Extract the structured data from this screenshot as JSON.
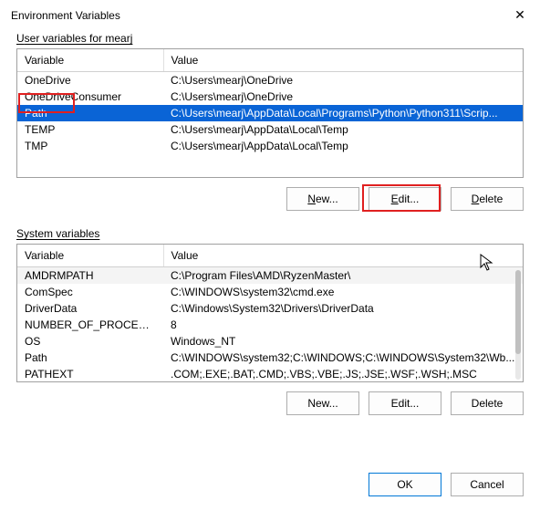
{
  "window": {
    "title": "Environment Variables"
  },
  "user_section": {
    "label_prefix": "U",
    "label_rest": "ser variables for mearj",
    "columns": {
      "variable": "Variable",
      "value": "Value"
    },
    "rows": [
      {
        "name": "OneDrive",
        "value": "C:\\Users\\mearj\\OneDrive"
      },
      {
        "name": "OneDriveConsumer",
        "value": "C:\\Users\\mearj\\OneDrive"
      },
      {
        "name": "Path",
        "value": "C:\\Users\\mearj\\AppData\\Local\\Programs\\Python\\Python311\\Scrip..."
      },
      {
        "name": "TEMP",
        "value": "C:\\Users\\mearj\\AppData\\Local\\Temp"
      },
      {
        "name": "TMP",
        "value": "C:\\Users\\mearj\\AppData\\Local\\Temp"
      }
    ],
    "buttons": {
      "new_ul": "N",
      "new_rest": "ew...",
      "edit_ul": "E",
      "edit_rest": "dit...",
      "delete_ul": "D",
      "delete_rest": "elete"
    }
  },
  "system_section": {
    "label_prefix": "S",
    "label_rest": "ystem variables",
    "columns": {
      "variable": "Variable",
      "value": "Value"
    },
    "rows": [
      {
        "name": "AMDRMPATH",
        "value": "C:\\Program Files\\AMD\\RyzenMaster\\"
      },
      {
        "name": "ComSpec",
        "value": "C:\\WINDOWS\\system32\\cmd.exe"
      },
      {
        "name": "DriverData",
        "value": "C:\\Windows\\System32\\Drivers\\DriverData"
      },
      {
        "name": "NUMBER_OF_PROCESSORS",
        "value": "8"
      },
      {
        "name": "OS",
        "value": "Windows_NT"
      },
      {
        "name": "Path",
        "value": "C:\\WINDOWS\\system32;C:\\WINDOWS;C:\\WINDOWS\\System32\\Wb..."
      },
      {
        "name": "PATHEXT",
        "value": ".COM;.EXE;.BAT;.CMD;.VBS;.VBE;.JS;.JSE;.WSF;.WSH;.MSC"
      }
    ],
    "buttons": {
      "new_label": "New...",
      "edit_label": "Edit...",
      "delete_label": "Delete"
    }
  },
  "footer": {
    "ok": "OK",
    "cancel": "Cancel"
  }
}
